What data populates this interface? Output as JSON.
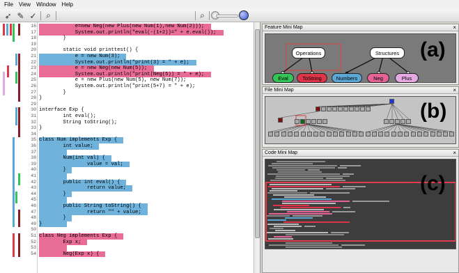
{
  "menu": [
    "File",
    "View",
    "Window",
    "Help"
  ],
  "toolbar_icons": [
    "select-icon",
    "edit-icon",
    "check-icon",
    "zoom-icon",
    "zoom-out-icon",
    "slider-knob-icon",
    "globe-icon"
  ],
  "code": [
    {
      "n": "16",
      "t": "            e=new Neg(new Plus(new Num(1),new Num(2)));",
      "hl": "p"
    },
    {
      "n": "17",
      "t": "            System.out.println(\"eval(-(1+2))=\" + e.eval());",
      "hl": "p"
    },
    {
      "n": "18",
      "t": "        }",
      "hl": ""
    },
    {
      "n": "19",
      "t": "",
      "hl": ""
    },
    {
      "n": "20",
      "t": "        static void printtest() {",
      "hl": ""
    },
    {
      "n": "21",
      "t": "            e = new Num(3);",
      "hl": "b"
    },
    {
      "n": "22",
      "t": "            System.out.println(\"print(3) = \" + e);",
      "hl": "b"
    },
    {
      "n": "23",
      "t": "            e = new Neg(new Num(5));",
      "hl": "p"
    },
    {
      "n": "24",
      "t": "            System.out.println(\"print(Neg(5)) = \" + e);",
      "hl": "p"
    },
    {
      "n": "25",
      "t": "            e = new Plus(new Num(5), new Num(7));",
      "hl": ""
    },
    {
      "n": "26",
      "t": "            System.out.println(\"print(5+7) = \" + e);",
      "hl": ""
    },
    {
      "n": "27",
      "t": "        }",
      "hl": ""
    },
    {
      "n": "28",
      "t": "}",
      "hl": ""
    },
    {
      "n": "29",
      "t": "",
      "hl": ""
    },
    {
      "n": "30",
      "t": "interface Exp {",
      "hl": ""
    },
    {
      "n": "31",
      "t": "        int eval();",
      "hl": ""
    },
    {
      "n": "32",
      "t": "        String toString();",
      "hl": ""
    },
    {
      "n": "33",
      "t": "}",
      "hl": ""
    },
    {
      "n": "34",
      "t": "",
      "hl": ""
    },
    {
      "n": "35",
      "t": "class Num implements Exp {",
      "hl": "b"
    },
    {
      "n": "36",
      "t": "        int value;",
      "hl": "b"
    },
    {
      "n": "37",
      "t": "",
      "hl": "b"
    },
    {
      "n": "38",
      "t": "        Num(int val) {",
      "hl": "b"
    },
    {
      "n": "39",
      "t": "                value = val;",
      "hl": "b"
    },
    {
      "n": "40",
      "t": "        }",
      "hl": "b"
    },
    {
      "n": "41",
      "t": "",
      "hl": "b"
    },
    {
      "n": "42",
      "t": "        public int eval() {",
      "hl": "b"
    },
    {
      "n": "43",
      "t": "                return value;",
      "hl": "b"
    },
    {
      "n": "44",
      "t": "        }",
      "hl": "b"
    },
    {
      "n": "45",
      "t": "",
      "hl": "b"
    },
    {
      "n": "46",
      "t": "        public String toString() {",
      "hl": "b"
    },
    {
      "n": "47",
      "t": "                return \"\" + value;",
      "hl": "b"
    },
    {
      "n": "48",
      "t": "        }",
      "hl": "b"
    },
    {
      "n": "49",
      "t": "}",
      "hl": "b"
    },
    {
      "n": "50",
      "t": "",
      "hl": ""
    },
    {
      "n": "51",
      "t": "class Neg implements Exp {",
      "hl": "p"
    },
    {
      "n": "52",
      "t": "        Exp x;",
      "hl": "p"
    },
    {
      "n": "53",
      "t": "",
      "hl": "p"
    },
    {
      "n": "54",
      "t": "        Neg(Exp x) {",
      "hl": "p"
    }
  ],
  "feature_panel": {
    "title": "Feature Mini Map",
    "label": "(a)",
    "nodes": [
      "Operations",
      "Structures",
      "Eval",
      "ToString",
      "Numbers",
      "Neg",
      "Plus"
    ]
  },
  "file_panel": {
    "title": "File Mini Map",
    "label": "(b)"
  },
  "code_panel": {
    "title": "Code Mini Map",
    "label": "(c)"
  },
  "close_glyph": "×"
}
